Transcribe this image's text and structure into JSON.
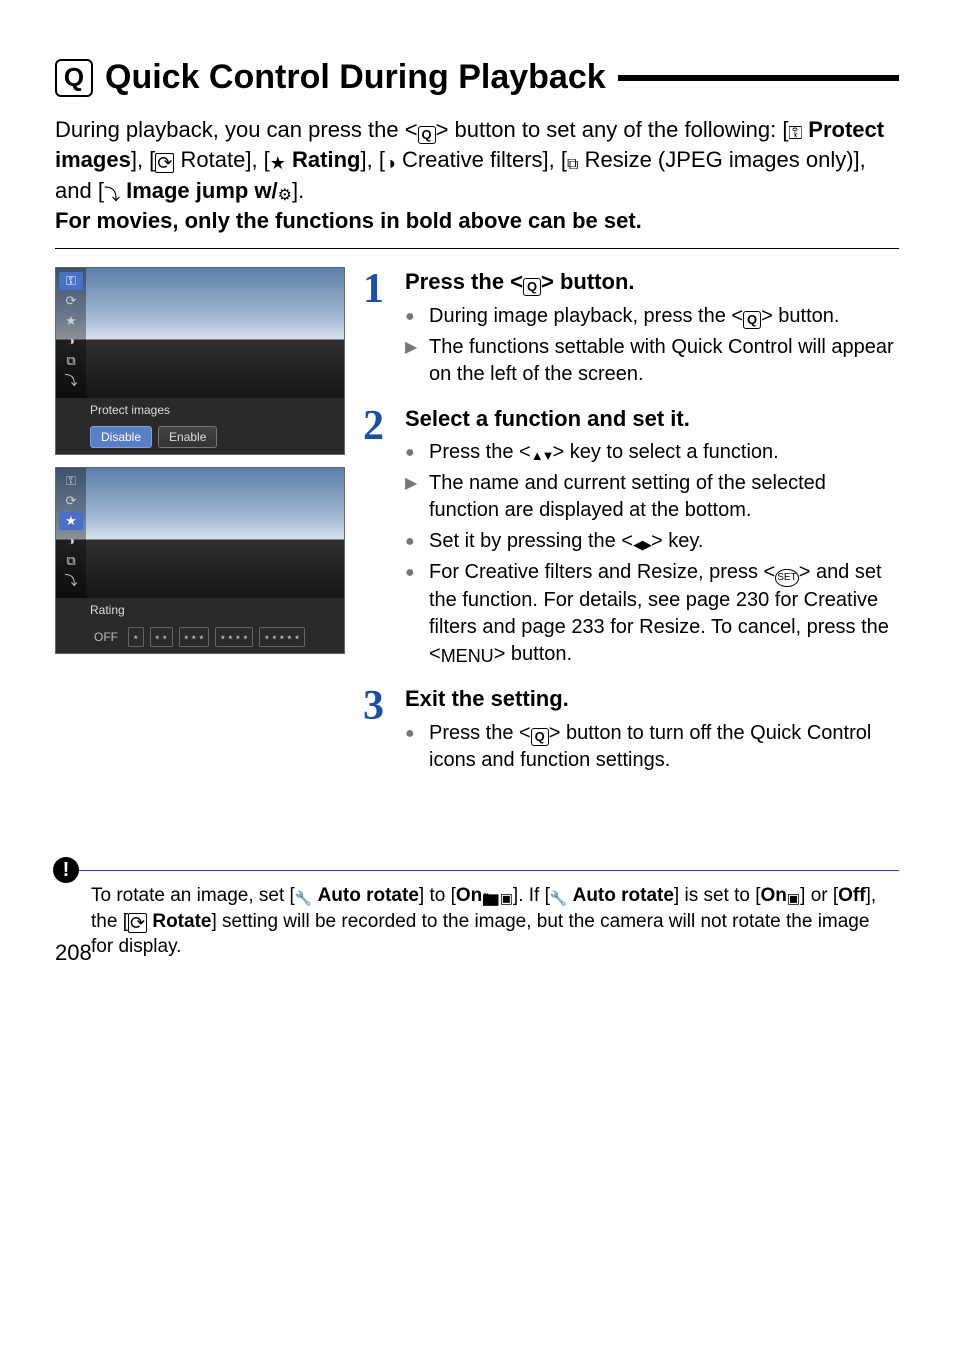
{
  "heading": {
    "icon_letter": "Q",
    "title": "Quick Control During Playback"
  },
  "intro": {
    "part1": "During playback, you can press the <",
    "part2": "> button to set any of the following: [",
    "protect": "Protect images",
    "part3": "], [",
    "rotate": "Rotate",
    "part4": "], [",
    "rating": "Rating",
    "part5": "], [",
    "creative": "Creative filters",
    "part6": "], [",
    "resize": "Resize (JPEG images only)",
    "part7": "], and [",
    "jump": "Image jump w/",
    "part8": "].",
    "bold_line": "For movies, only the functions in bold above can be set."
  },
  "thumb1": {
    "label": "Protect images",
    "opt_disable": "Disable",
    "opt_enable": "Enable",
    "sidebar": [
      "⚿",
      "⟳",
      "★",
      "◑",
      "⧉",
      "⤵"
    ]
  },
  "thumb2": {
    "label": "Rating",
    "opt_off": "OFF",
    "opts": [
      "⋆",
      "⋆⋆",
      "⋆⋆⋆",
      "⋆⋆⋆⋆",
      "⋆⋆⋆⋆⋆"
    ],
    "sidebar": [
      "⚿",
      "⟳",
      "★",
      "◑",
      "⧉",
      "⤵"
    ]
  },
  "steps": [
    {
      "num": "1",
      "title_a": "Press the <",
      "title_b": "> button.",
      "items": [
        {
          "marker": "●",
          "pre": "During image playback, press the <",
          "mid": "> button."
        },
        {
          "marker": "▶",
          "text": "The functions settable with Quick Control will appear on the left of the screen."
        }
      ]
    },
    {
      "num": "2",
      "title": "Select a function and set it.",
      "items": [
        {
          "marker": "●",
          "pre": "Press the <",
          "post": "> key to select a function."
        },
        {
          "marker": "▶",
          "text": "The name and current setting of the selected function are displayed at the bottom."
        },
        {
          "marker": "●",
          "pre2": "Set it by pressing the <",
          "post2": "> key."
        },
        {
          "marker": "●",
          "cf_pre": "For Creative filters and Resize, press <",
          "cf_mid": "> and set the function. For details, see page 230 for Creative filters and page 233 for Resize. To cancel, press the <",
          "cf_menu": "MENU",
          "cf_post": "> button."
        }
      ]
    },
    {
      "num": "3",
      "title": "Exit the setting.",
      "items": [
        {
          "marker": "●",
          "pre": "Press the <",
          "post": "> button to turn off the Quick Control icons and function settings."
        }
      ]
    }
  ],
  "note": {
    "icon": "!",
    "t1": "To rotate an image, set [",
    "auto_rotate": "Auto rotate",
    "t2": "] to [",
    "on": "On",
    "t3": "]. If [",
    "t4": "] is set to [",
    "t5": "] or [",
    "off": "Off",
    "t6": "], the [",
    "rotate": "Rotate",
    "t7": "] setting will be recorded to the image, but the camera will not rotate the image for display."
  },
  "page_number": "208"
}
